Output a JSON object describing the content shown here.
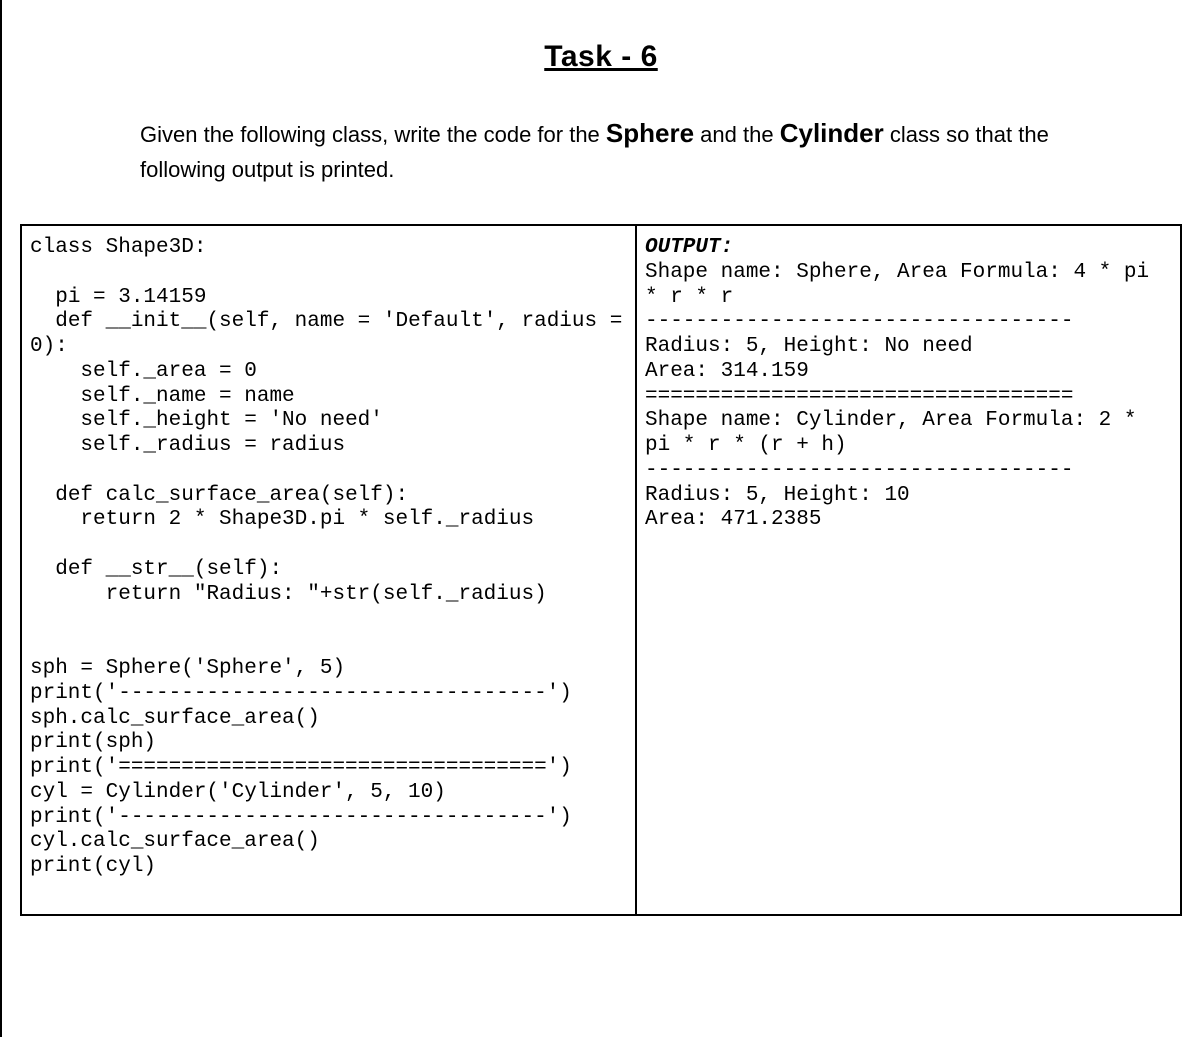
{
  "title": "Task - 6",
  "description_part1": "Given the following class, write the code for the ",
  "description_bold1": "Sphere",
  "description_part2": " and the ",
  "description_bold2": "Cylinder",
  "description_part3": " class so that the following output is printed.",
  "code_left": "class Shape3D:\n\n  pi = 3.14159\n  def __init__(self, name = 'Default', radius = 0):\n    self._area = 0\n    self._name = name\n    self._height = 'No need'\n    self._radius = radius\n\n  def calc_surface_area(self):\n    return 2 * Shape3D.pi * self._radius\n\n  def __str__(self):\n      return \"Radius: \"+str(self._radius)\n\n\nsph = Sphere('Sphere', 5)\nprint('----------------------------------')\nsph.calc_surface_area()\nprint(sph)\nprint('==================================')\ncyl = Cylinder('Cylinder', 5, 10)\nprint('----------------------------------')\ncyl.calc_surface_area()\nprint(cyl)",
  "output_label": "OUTPUT:",
  "output_text": "Shape name: Sphere, Area Formula: 4 * pi * r * r\n----------------------------------\nRadius: 5, Height: No need\nArea: 314.159\n==================================\nShape name: Cylinder, Area Formula: 2 * pi * r * (r + h)\n----------------------------------\nRadius: 5, Height: 10\nArea: 471.2385"
}
